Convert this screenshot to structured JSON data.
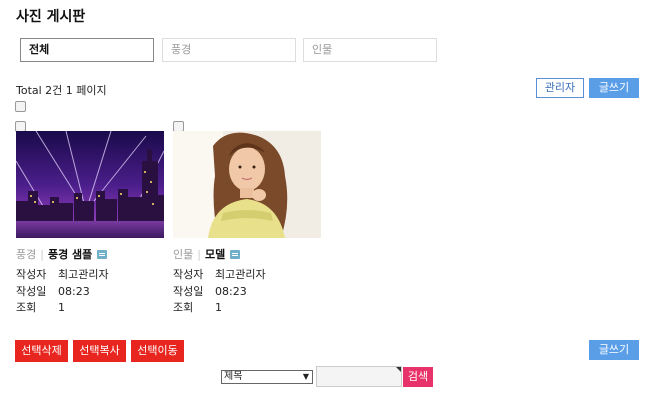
{
  "board": {
    "title": "사진 게시판",
    "categories": [
      {
        "label": "전체",
        "active": true
      },
      {
        "label": "풍경",
        "active": false
      },
      {
        "label": "인물",
        "active": false
      }
    ],
    "total_text": "Total 2건 1 페이지",
    "admin_label": "관리자",
    "write_label": "글쓰기"
  },
  "posts": [
    {
      "category": "풍경",
      "subject": "풍경 샘플",
      "author_key": "작성자",
      "author": "최고관리자",
      "date_key": "작성일",
      "date": "08:23",
      "hits_key": "조회",
      "hits": "1"
    },
    {
      "category": "인물",
      "subject": "모델",
      "author_key": "작성자",
      "author": "최고관리자",
      "date_key": "작성일",
      "date": "08:23",
      "hits_key": "조회",
      "hits": "1"
    }
  ],
  "actions": {
    "delete_label": "선택삭제",
    "copy_label": "선택복사",
    "move_label": "선택이동",
    "write_label": "글쓰기"
  },
  "search": {
    "field_selected": "제목",
    "value": "",
    "button_label": "검색"
  },
  "colors": {
    "red": "#e8251e",
    "blue": "#5a9ee8",
    "search_pink": "#e8336a"
  }
}
